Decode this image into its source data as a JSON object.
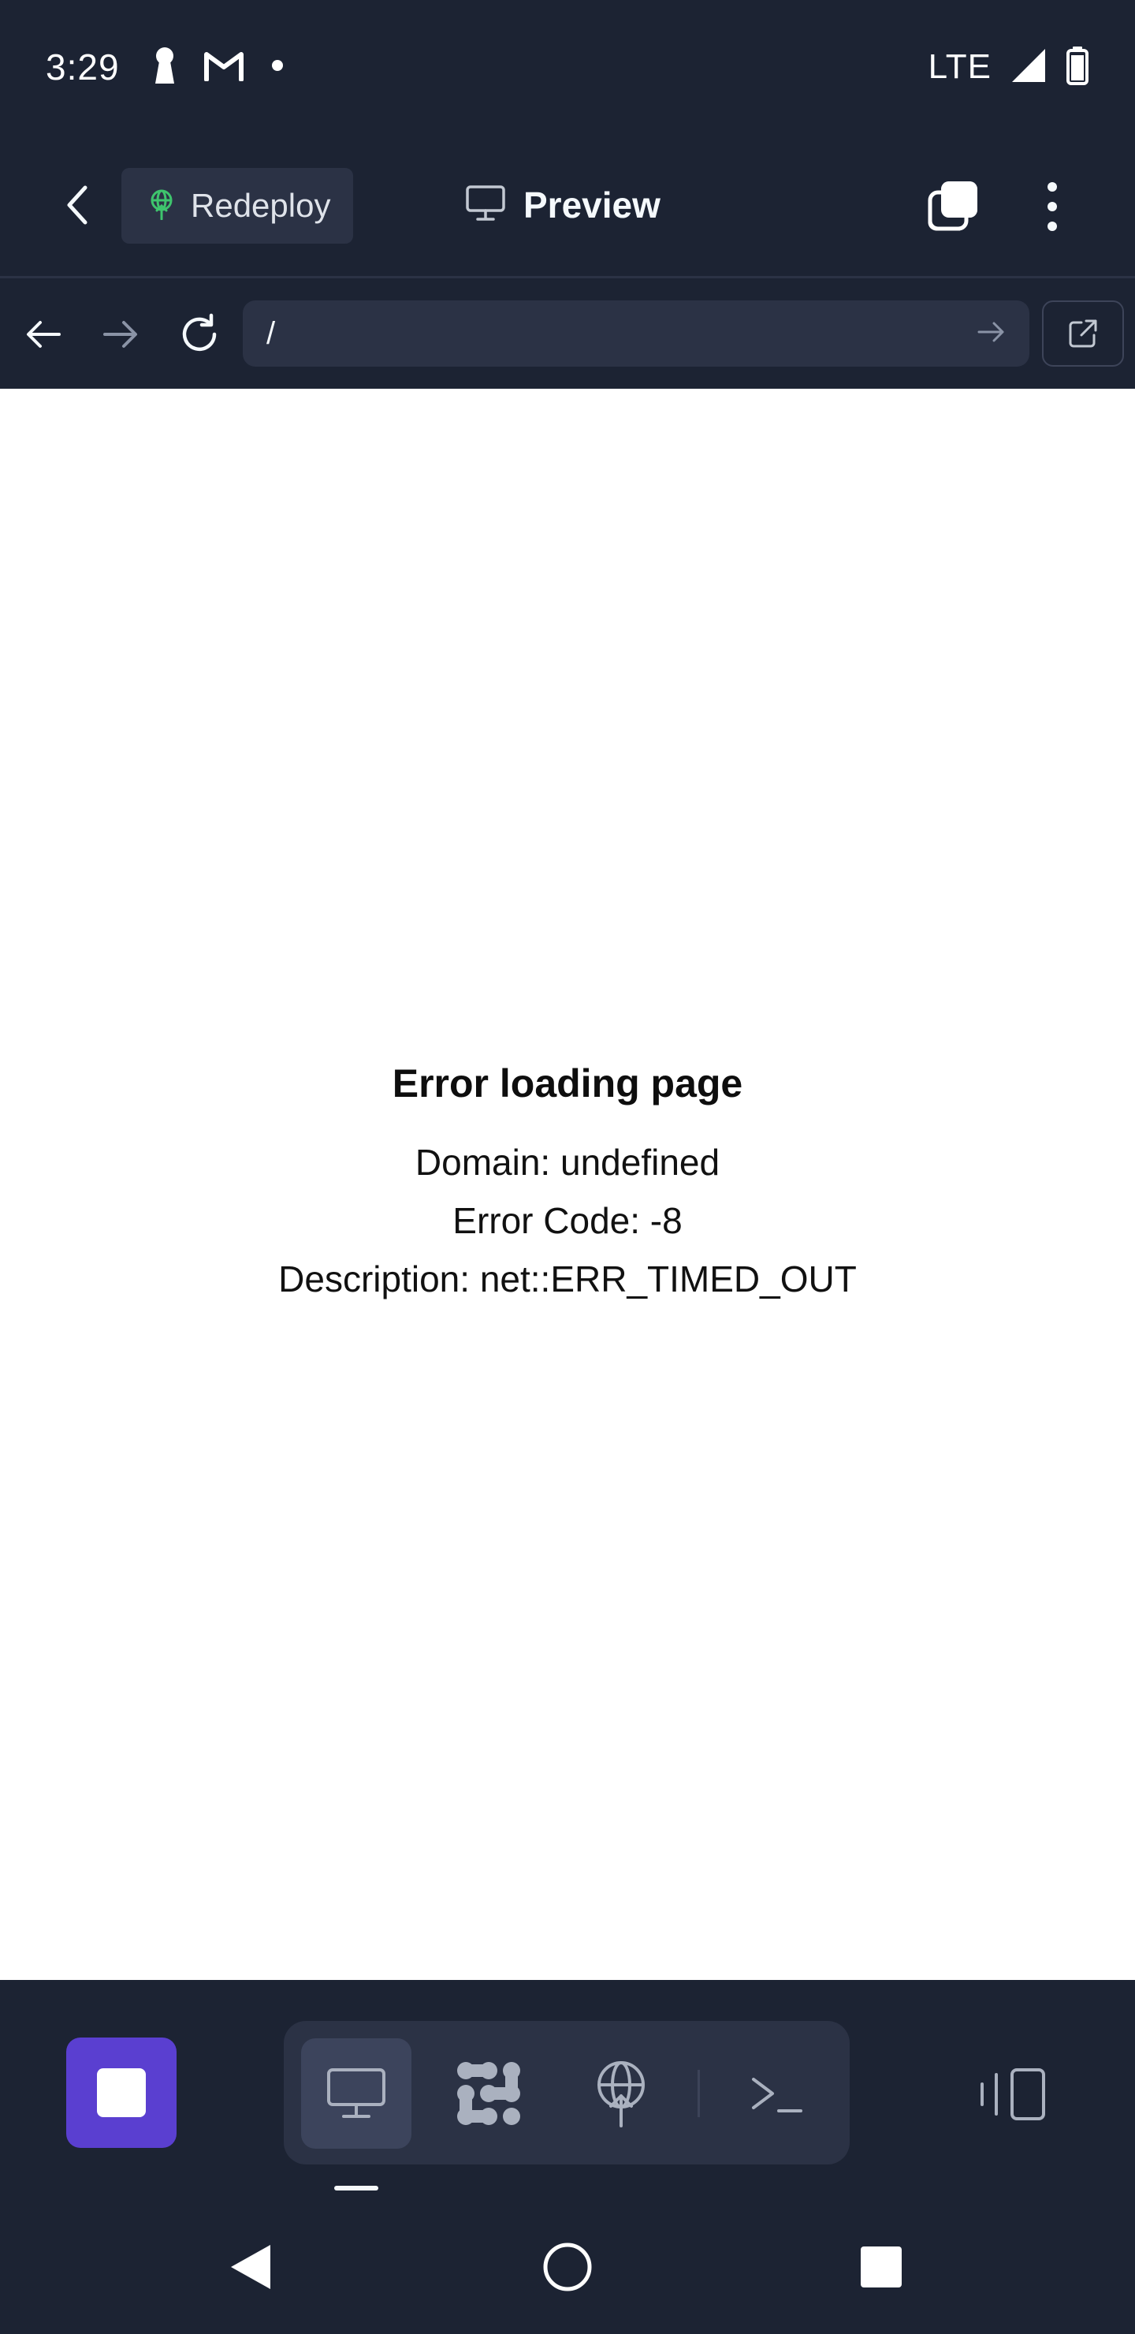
{
  "status_bar": {
    "time": "3:29",
    "network": "LTE",
    "left_icons": [
      "keyhole-icon",
      "gmail-icon",
      "notification-dot-icon"
    ],
    "right_icons": [
      "signal-icon",
      "battery-icon"
    ]
  },
  "header": {
    "redeploy_label": "Redeploy",
    "title": "Preview",
    "icons": [
      "back-chevron-icon",
      "deploy-globe-icon",
      "monitor-icon",
      "tabs-icon",
      "more-vert-icon"
    ]
  },
  "browser": {
    "url": "/",
    "icons": [
      "back-arrow-icon",
      "forward-arrow-icon",
      "reload-icon",
      "go-arrow-icon",
      "open-external-icon"
    ]
  },
  "webview": {
    "error_title": "Error loading page",
    "domain_line": "Domain: undefined",
    "code_line": "Error Code: -8",
    "description_line": "Description: net::ERR_TIMED_OUT"
  },
  "toolbar": {
    "tools": [
      "stop-icon",
      "webview-monitor-icon",
      "workflow-icon",
      "deployments-icon",
      "shell-icon",
      "panel-toggle-icon"
    ],
    "active_tool": "webview-monitor-icon"
  },
  "colors": {
    "background": "#1c2333",
    "surface": "#2b3245",
    "accent": "#5a3fd0",
    "deploy_green": "#3ec46d"
  }
}
